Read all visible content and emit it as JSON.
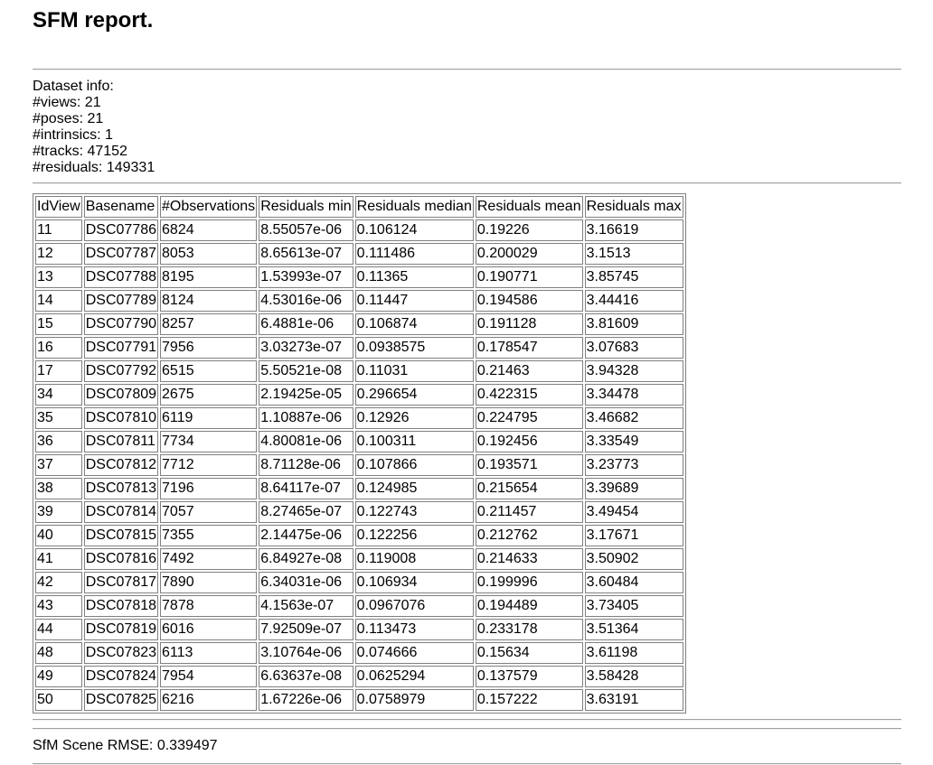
{
  "title": "SFM report.",
  "dataset_info": {
    "heading": "Dataset info:",
    "views": "#views: 21",
    "poses": "#poses: 21",
    "intrinsics": "#intrinsics: 1",
    "tracks": "#tracks: 47152",
    "residuals": "#residuals: 149331"
  },
  "table": {
    "headers": [
      "IdView",
      "Basename",
      "#Observations",
      "Residuals min",
      "Residuals median",
      "Residuals mean",
      "Residuals max"
    ],
    "rows": [
      [
        "11",
        "DSC07786",
        "6824",
        "8.55057e-06",
        "0.106124",
        "0.19226",
        "3.16619"
      ],
      [
        "12",
        "DSC07787",
        "8053",
        "8.65613e-07",
        "0.111486",
        "0.200029",
        "3.1513"
      ],
      [
        "13",
        "DSC07788",
        "8195",
        "1.53993e-07",
        "0.11365",
        "0.190771",
        "3.85745"
      ],
      [
        "14",
        "DSC07789",
        "8124",
        "4.53016e-06",
        "0.11447",
        "0.194586",
        "3.44416"
      ],
      [
        "15",
        "DSC07790",
        "8257",
        "6.4881e-06",
        "0.106874",
        "0.191128",
        "3.81609"
      ],
      [
        "16",
        "DSC07791",
        "7956",
        "3.03273e-07",
        "0.0938575",
        "0.178547",
        "3.07683"
      ],
      [
        "17",
        "DSC07792",
        "6515",
        "5.50521e-08",
        "0.11031",
        "0.21463",
        "3.94328"
      ],
      [
        "34",
        "DSC07809",
        "2675",
        "2.19425e-05",
        "0.296654",
        "0.422315",
        "3.34478"
      ],
      [
        "35",
        "DSC07810",
        "6119",
        "1.10887e-06",
        "0.12926",
        "0.224795",
        "3.46682"
      ],
      [
        "36",
        "DSC07811",
        "7734",
        "4.80081e-06",
        "0.100311",
        "0.192456",
        "3.33549"
      ],
      [
        "37",
        "DSC07812",
        "7712",
        "8.71128e-06",
        "0.107866",
        "0.193571",
        "3.23773"
      ],
      [
        "38",
        "DSC07813",
        "7196",
        "8.64117e-07",
        "0.124985",
        "0.215654",
        "3.39689"
      ],
      [
        "39",
        "DSC07814",
        "7057",
        "8.27465e-07",
        "0.122743",
        "0.211457",
        "3.49454"
      ],
      [
        "40",
        "DSC07815",
        "7355",
        "2.14475e-06",
        "0.122256",
        "0.212762",
        "3.17671"
      ],
      [
        "41",
        "DSC07816",
        "7492",
        "6.84927e-08",
        "0.119008",
        "0.214633",
        "3.50902"
      ],
      [
        "42",
        "DSC07817",
        "7890",
        "6.34031e-06",
        "0.106934",
        "0.199996",
        "3.60484"
      ],
      [
        "43",
        "DSC07818",
        "7878",
        "4.1563e-07",
        "0.0967076",
        "0.194489",
        "3.73405"
      ],
      [
        "44",
        "DSC07819",
        "6016",
        "7.92509e-07",
        "0.113473",
        "0.233178",
        "3.51364"
      ],
      [
        "48",
        "DSC07823",
        "6113",
        "3.10764e-06",
        "0.074666",
        "0.15634",
        "3.61198"
      ],
      [
        "49",
        "DSC07824",
        "7954",
        "6.63637e-08",
        "0.0625294",
        "0.137579",
        "3.58428"
      ],
      [
        "50",
        "DSC07825",
        "6216",
        "1.67226e-06",
        "0.0758979",
        "0.157222",
        "3.63191"
      ]
    ]
  },
  "rmse": "SfM Scene RMSE: 0.339497"
}
